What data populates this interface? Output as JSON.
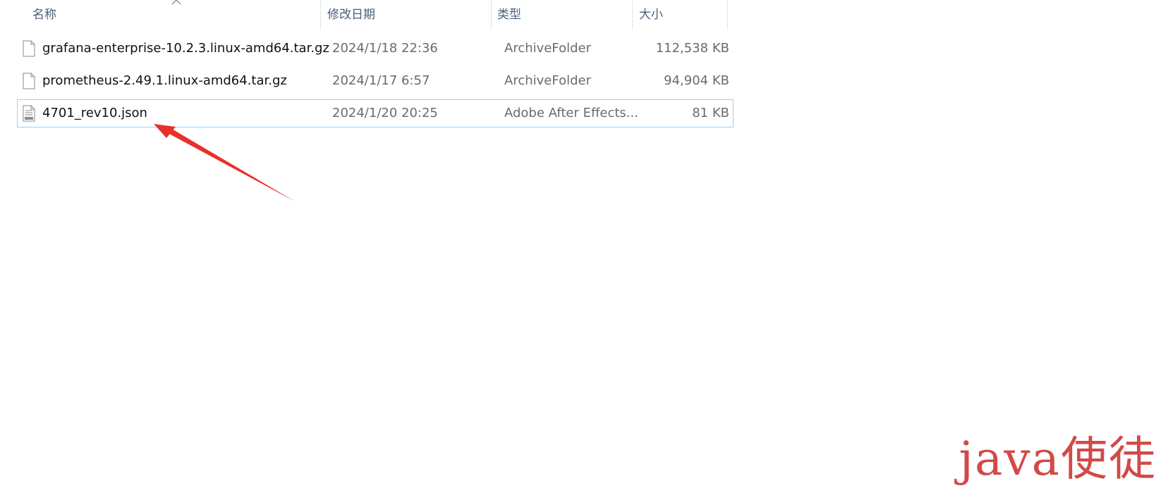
{
  "columns": {
    "name": "名称",
    "date": "修改日期",
    "type": "类型",
    "size": "大小"
  },
  "sort": {
    "column": "name",
    "direction": "ascending",
    "icon": "chevron-up-icon"
  },
  "files": [
    {
      "name": "grafana-enterprise-10.2.3.linux-amd64.tar.gz",
      "date": "2024/1/18 22:36",
      "type": "ArchiveFolder",
      "size": "112,538 KB",
      "icon": "file-icon",
      "selected": false
    },
    {
      "name": "prometheus-2.49.1.linux-amd64.tar.gz",
      "date": "2024/1/17 6:57",
      "type": "ArchiveFolder",
      "size": "94,904 KB",
      "icon": "file-icon",
      "selected": false
    },
    {
      "name": "4701_rev10.json",
      "date": "2024/1/20 20:25",
      "type": "Adobe After Effects...",
      "size": "81 KB",
      "icon": "json-file-icon",
      "selected": true
    }
  ],
  "annotation": {
    "icon": "red-arrow-icon",
    "color": "#e8302a",
    "points_to": "4701_rev10.json"
  },
  "watermark": {
    "text": "java使徒",
    "color": "#d14a47"
  }
}
